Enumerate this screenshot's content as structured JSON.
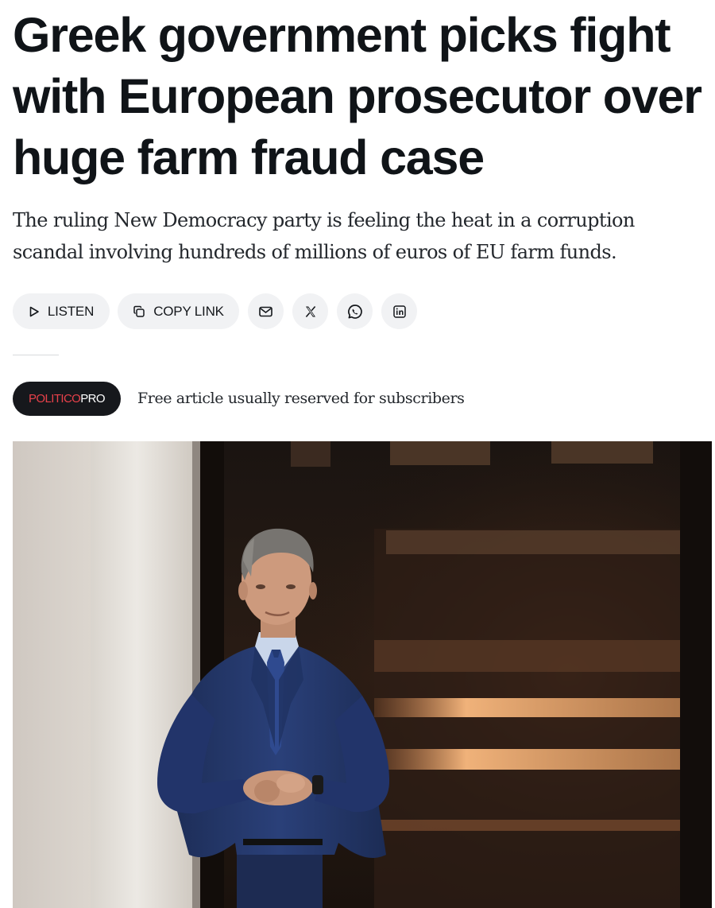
{
  "article": {
    "headline": "Greek government picks fight with European prosecutor over huge farm fraud case",
    "dek": "The ruling New Democracy party is feeling the heat in a corruption scandal involving hundreds of millions of euros of EU farm funds."
  },
  "share_bar": {
    "listen_label": "LISTEN",
    "copy_link_label": "COPY LINK",
    "buttons": [
      {
        "icon": "play-icon",
        "label": "LISTEN"
      },
      {
        "icon": "copy-icon",
        "label": "COPY LINK"
      },
      {
        "icon": "mail-icon"
      },
      {
        "icon": "x-icon"
      },
      {
        "icon": "whatsapp-icon"
      },
      {
        "icon": "linkedin-icon"
      }
    ]
  },
  "pro": {
    "brand_part1": "POLITICO",
    "brand_part2": "PRO",
    "note": "Free article usually reserved for subscribers"
  },
  "hero_image": {
    "description_icon": "photo",
    "colors": {
      "suit": "#23386b",
      "background_dark": "#1e1612",
      "light_strip": "#e8a06a",
      "column": "#e6e2dd"
    }
  },
  "colors": {
    "text": "#101418",
    "pill_bg": "#f1f2f4",
    "badge_bg": "#16181c",
    "brand_red": "#e8414a"
  }
}
